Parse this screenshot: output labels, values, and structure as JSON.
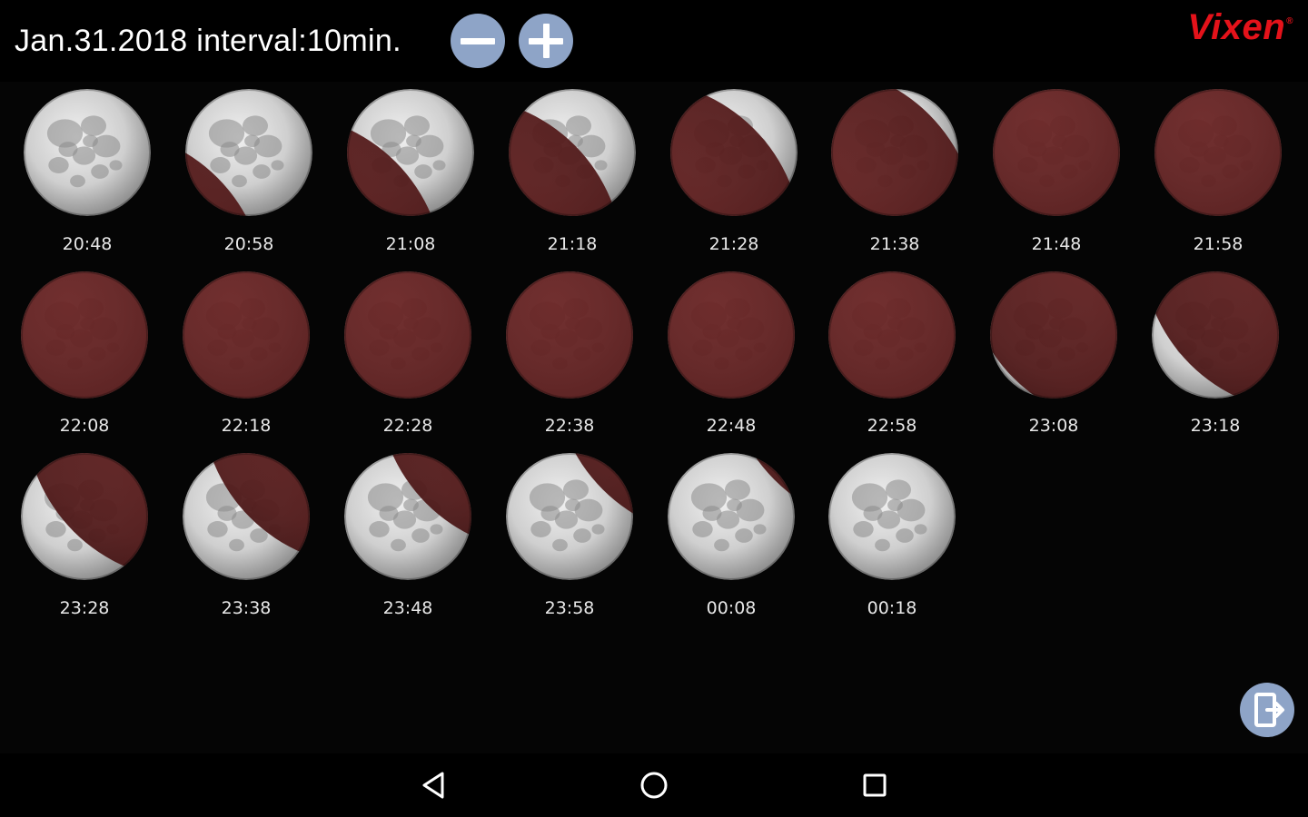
{
  "header": {
    "title": "Jan.31.2018  interval:10min.",
    "zoom_out_icon": "minus-icon",
    "zoom_in_icon": "plus-icon",
    "brand": "Vixen",
    "brand_mark": "®"
  },
  "moons": [
    {
      "time": "20:48",
      "shadow": 0.0
    },
    {
      "time": "20:58",
      "shadow": 0.18
    },
    {
      "time": "21:08",
      "shadow": 0.36
    },
    {
      "time": "21:18",
      "shadow": 0.55
    },
    {
      "time": "21:28",
      "shadow": 0.74
    },
    {
      "time": "21:38",
      "shadow": 0.9
    },
    {
      "time": "21:48",
      "shadow": 1.0
    },
    {
      "time": "21:58",
      "shadow": 1.0
    },
    {
      "time": "22:08",
      "shadow": 1.0
    },
    {
      "time": "22:18",
      "shadow": 1.0
    },
    {
      "time": "22:28",
      "shadow": 1.0
    },
    {
      "time": "22:38",
      "shadow": 1.0
    },
    {
      "time": "22:48",
      "shadow": 1.0
    },
    {
      "time": "22:58",
      "shadow": 1.0
    },
    {
      "time": "23:08",
      "shadow": 0.96
    },
    {
      "time": "23:18",
      "shadow": 0.8
    },
    {
      "time": "23:28",
      "shadow": 0.64
    },
    {
      "time": "23:38",
      "shadow": 0.48
    },
    {
      "time": "23:48",
      "shadow": 0.32
    },
    {
      "time": "23:58",
      "shadow": 0.16
    },
    {
      "time": "00:08",
      "shadow": 0.05
    },
    {
      "time": "00:18",
      "shadow": 0.0
    }
  ],
  "exit_icon": "exit-door-icon",
  "navbar": {
    "back_icon": "back-triangle-icon",
    "home_icon": "home-circle-icon",
    "recents_icon": "recents-square-icon"
  },
  "colors": {
    "background": "#050505",
    "button": "#8ea4c7",
    "brand": "#e4121a",
    "eclipse_shadow": "#5a1d1d",
    "moon_light": "#d9d9d9"
  }
}
